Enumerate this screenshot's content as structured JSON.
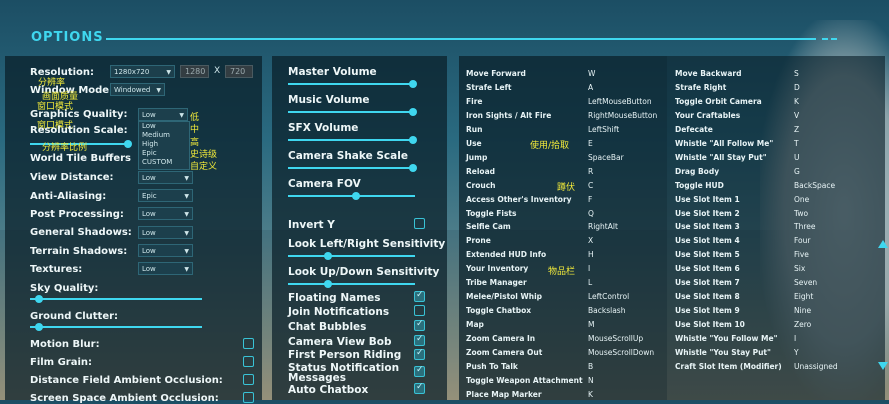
{
  "header": {
    "title": "OPTIONS"
  },
  "video": {
    "resolution": {
      "label": "Resolution:",
      "value": "1280x720",
      "width": "1280",
      "x": "X",
      "height": "720"
    },
    "window_mode": {
      "label": "Window Mode:",
      "value": "Windowed"
    },
    "graphics_quality": {
      "label": "Graphics Quality:",
      "value": "Low",
      "options": [
        "Low",
        "Medium",
        "High",
        "Epic",
        "CUSTOM"
      ]
    },
    "resolution_scale": {
      "label": "Resolution Scale:"
    },
    "world_tile_buffers": {
      "label": "World Tile Buffers"
    },
    "view_distance": {
      "label": "View Distance:",
      "value": "Low"
    },
    "anti_aliasing": {
      "label": "Anti-Aliasing:",
      "value": "Epic"
    },
    "post_processing": {
      "label": "Post Processing:",
      "value": "Low"
    },
    "general_shadows": {
      "label": "General Shadows:",
      "value": "Low"
    },
    "terrain_shadows": {
      "label": "Terrain Shadows:",
      "value": "Low"
    },
    "textures": {
      "label": "Textures:",
      "value": "Low"
    },
    "sky_quality": {
      "label": "Sky Quality:"
    },
    "ground_clutter": {
      "label": "Ground Clutter:"
    },
    "motion_blur": {
      "label": "Motion Blur:"
    },
    "film_grain": {
      "label": "Film Grain:"
    },
    "distance_field": {
      "label": "Distance Field Ambient Occlusion:"
    },
    "screen_space": {
      "label": "Screen Space Ambient Occlusion:"
    }
  },
  "annotations": {
    "resolution": "分辨率",
    "graphics_quality": "画面质量",
    "window_mode": "窗口模式",
    "resolution_scale": "分辨率比例",
    "quality_options": [
      "低",
      "中",
      "高",
      "史诗级",
      "自定义"
    ],
    "use": "使用/拾取",
    "crouch": "蹲伏",
    "inventory": "物品栏"
  },
  "audio": {
    "master_volume": "Master Volume",
    "music_volume": "Music Volume",
    "sfx_volume": "SFX Volume",
    "camera_shake_scale": "Camera Shake Scale",
    "camera_fov": "Camera FOV",
    "invert_y": "Invert Y",
    "look_lr": "Look Left/Right Sensitivity",
    "look_ud": "Look Up/Down Sensitivity",
    "floating_names": "Floating Names",
    "join_notifications": "Join Notifications",
    "chat_bubbles": "Chat Bubbles",
    "camera_view_bob": "Camera View Bob",
    "first_person_riding": "First Person Riding",
    "status_notification_messages_1": "Status Notification",
    "status_notification_messages_2": "Messages",
    "auto_chatbox": "Auto Chatbox"
  },
  "bindings_left": [
    {
      "action": "Move Forward",
      "key": "W"
    },
    {
      "action": "Strafe Left",
      "key": "A"
    },
    {
      "action": "Fire",
      "key": "LeftMouseButton"
    },
    {
      "action": "Iron Sights / Alt Fire",
      "key": "RightMouseButton"
    },
    {
      "action": "Run",
      "key": "LeftShift"
    },
    {
      "action": "Use",
      "key": "E"
    },
    {
      "action": "Jump",
      "key": "SpaceBar"
    },
    {
      "action": "Reload",
      "key": "R"
    },
    {
      "action": "Crouch",
      "key": "C"
    },
    {
      "action": "Access Other's Inventory",
      "key": "F"
    },
    {
      "action": "Toggle Fists",
      "key": "Q"
    },
    {
      "action": "Selfie Cam",
      "key": "RightAlt"
    },
    {
      "action": "Prone",
      "key": "X"
    },
    {
      "action": "Extended HUD Info",
      "key": "H"
    },
    {
      "action": "Your Inventory",
      "key": "I"
    },
    {
      "action": "Tribe Manager",
      "key": "L"
    },
    {
      "action": "Melee/Pistol Whip",
      "key": "LeftControl"
    },
    {
      "action": "Toggle Chatbox",
      "key": "Backslash"
    },
    {
      "action": "Map",
      "key": "M"
    },
    {
      "action": "Zoom Camera In",
      "key": "MouseScrollUp"
    },
    {
      "action": "Zoom Camera Out",
      "key": "MouseScrollDown"
    },
    {
      "action": "Push To Talk",
      "key": "B"
    },
    {
      "action": "Toggle Weapon Attachment",
      "key": "N"
    },
    {
      "action": "Place Map Marker",
      "key": "K"
    }
  ],
  "bindings_right": [
    {
      "action": "Move Backward",
      "key": "S"
    },
    {
      "action": "Strafe Right",
      "key": "D"
    },
    {
      "action": "Toggle Orbit Camera",
      "key": "K"
    },
    {
      "action": "Your Craftables",
      "key": "V"
    },
    {
      "action": "Defecate",
      "key": "Z"
    },
    {
      "action": "Whistle \"All Follow Me\"",
      "key": "T"
    },
    {
      "action": "Whistle \"All Stay Put\"",
      "key": "U"
    },
    {
      "action": "Drag Body",
      "key": "G"
    },
    {
      "action": "Toggle HUD",
      "key": "BackSpace"
    },
    {
      "action": "Use Slot Item 1",
      "key": "One"
    },
    {
      "action": "Use Slot Item 2",
      "key": "Two"
    },
    {
      "action": "Use Slot Item 3",
      "key": "Three"
    },
    {
      "action": "Use Slot Item 4",
      "key": "Four"
    },
    {
      "action": "Use Slot Item 5",
      "key": "Five"
    },
    {
      "action": "Use Slot Item 6",
      "key": "Six"
    },
    {
      "action": "Use Slot Item 7",
      "key": "Seven"
    },
    {
      "action": "Use Slot Item 8",
      "key": "Eight"
    },
    {
      "action": "Use Slot Item 9",
      "key": "Nine"
    },
    {
      "action": "Use Slot Item 10",
      "key": "Zero"
    },
    {
      "action": "Whistle \"You Follow Me\"",
      "key": "I"
    },
    {
      "action": "Whistle \"You Stay Put\"",
      "key": "Y"
    },
    {
      "action": "Craft Slot Item (Modifier)",
      "key": "Unassigned"
    }
  ]
}
